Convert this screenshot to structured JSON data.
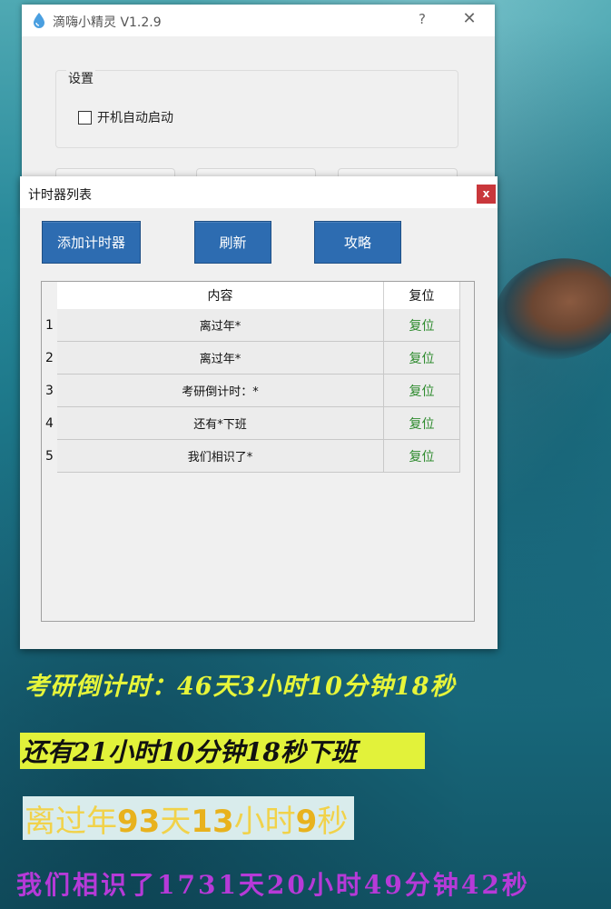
{
  "main_window": {
    "title": "滴嗨小精灵 V1.2.9",
    "help": "?",
    "close": "✕",
    "settings_group": "设置",
    "autostart_label": "开机自动启动",
    "autostart_checked": false
  },
  "timer_dialog": {
    "title": "计时器列表",
    "close": "x",
    "buttons": {
      "add": "添加计时器",
      "refresh": "刷新",
      "guide": "攻略"
    },
    "columns": [
      "内容",
      "复位"
    ],
    "rows": [
      {
        "num": "1",
        "content": "离过年*",
        "reset": "复位"
      },
      {
        "num": "2",
        "content": "离过年*",
        "reset": "复位"
      },
      {
        "num": "3",
        "content": "考研倒计时：*",
        "reset": "复位"
      },
      {
        "num": "4",
        "content": "还有*下班",
        "reset": "复位"
      },
      {
        "num": "5",
        "content": "我们相识了*",
        "reset": "复位"
      }
    ]
  },
  "overlays": {
    "exam_countdown": "考研倒计时：46天3小时10分钟18秒",
    "off_work": "还有21小时10分钟18秒下班",
    "new_year": {
      "prefix": "离过年",
      "days": "93",
      "t1": "天",
      "hours": "13",
      "t2": "小时",
      "seconds": "9",
      "t3": "秒"
    },
    "acquainted": "我们相识了1731天20小时49分钟42秒"
  },
  "colors": {
    "button_blue": "#2d6cb1",
    "reset_green": "#2e8b2e",
    "close_red": "#c9373b",
    "overlay_yellow": "#e7f53a",
    "overlay_purple": "#b63ad8"
  }
}
